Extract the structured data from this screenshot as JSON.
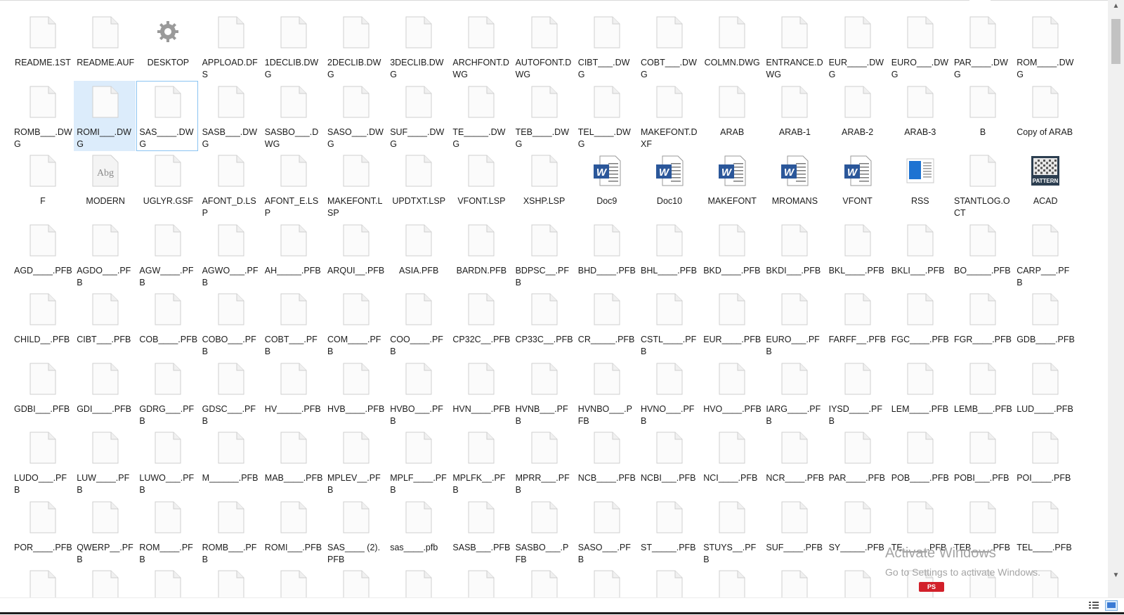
{
  "watermark": {
    "title": "Activate Windows",
    "subtitle": "Go to Settings to activate Windows."
  },
  "partial_badge": "PS",
  "colors": {
    "selection": "#dcecfb",
    "focus_border": "#8ac4f2",
    "word_blue": "#2b579a"
  },
  "files": [
    {
      "name": "README.1ST",
      "icon": "blank"
    },
    {
      "name": "README.AUF",
      "icon": "blank"
    },
    {
      "name": "DESKTOP",
      "icon": "settings"
    },
    {
      "name": "APPLOAD.DFS",
      "icon": "blank"
    },
    {
      "name": "1DECLIB.DWG",
      "icon": "blank"
    },
    {
      "name": "2DECLIB.DWG",
      "icon": "blank"
    },
    {
      "name": "3DECLIB.DWG",
      "icon": "blank"
    },
    {
      "name": "ARCHFONT.DWG",
      "icon": "blank"
    },
    {
      "name": "AUTOFONT.DWG",
      "icon": "blank"
    },
    {
      "name": "CIBT___.DWG",
      "icon": "blank"
    },
    {
      "name": "COBT___.DWG",
      "icon": "blank"
    },
    {
      "name": "COLMN.DWG",
      "icon": "blank"
    },
    {
      "name": "ENTRANCE.DWG",
      "icon": "blank"
    },
    {
      "name": "EUR____.DWG",
      "icon": "blank"
    },
    {
      "name": "EURO___.DWG",
      "icon": "blank"
    },
    {
      "name": "PAR____.DWG",
      "icon": "blank"
    },
    {
      "name": "ROM____.DWG",
      "icon": "blank"
    },
    {
      "name": "ROMB___.DWG",
      "icon": "blank"
    },
    {
      "name": "ROMI___.DWG",
      "icon": "blank",
      "selected": true
    },
    {
      "name": "SAS____.DWG",
      "icon": "blank",
      "focused": true
    },
    {
      "name": "SASB___.DWG",
      "icon": "blank"
    },
    {
      "name": "SASBO___.DWG",
      "icon": "blank"
    },
    {
      "name": "SASO___.DWG",
      "icon": "blank"
    },
    {
      "name": "SUF____.DWG",
      "icon": "blank"
    },
    {
      "name": "TE_____.DWG",
      "icon": "blank"
    },
    {
      "name": "TEB____.DWG",
      "icon": "blank"
    },
    {
      "name": "TEL____.DWG",
      "icon": "blank"
    },
    {
      "name": "MAKEFONT.DXF",
      "icon": "blank"
    },
    {
      "name": "ARAB",
      "icon": "blank"
    },
    {
      "name": "ARAB-1",
      "icon": "blank"
    },
    {
      "name": "ARAB-2",
      "icon": "blank"
    },
    {
      "name": "ARAB-3",
      "icon": "blank"
    },
    {
      "name": "B",
      "icon": "blank"
    },
    {
      "name": "Copy of ARAB",
      "icon": "blank"
    },
    {
      "name": "F",
      "icon": "blank"
    },
    {
      "name": "MODERN",
      "icon": "font",
      "icon_text": "Abg"
    },
    {
      "name": "UGLYR.GSF",
      "icon": "blank"
    },
    {
      "name": "AFONT_D.LSP",
      "icon": "blank"
    },
    {
      "name": "AFONT_E.LSP",
      "icon": "blank"
    },
    {
      "name": "MAKEFONT.LSP",
      "icon": "blank"
    },
    {
      "name": "UPDTXT.LSP",
      "icon": "blank"
    },
    {
      "name": "VFONT.LSP",
      "icon": "blank"
    },
    {
      "name": "XSHP.LSP",
      "icon": "blank"
    },
    {
      "name": "Doc9",
      "icon": "word",
      "icon_text": "W"
    },
    {
      "name": "Doc10",
      "icon": "word",
      "icon_text": "W"
    },
    {
      "name": "MAKEFONT",
      "icon": "word",
      "icon_text": "W"
    },
    {
      "name": "MROMANS",
      "icon": "word",
      "icon_text": "W"
    },
    {
      "name": "VFONT",
      "icon": "word",
      "icon_text": "W"
    },
    {
      "name": "RSS",
      "icon": "rss"
    },
    {
      "name": "STANTLOG.OCT",
      "icon": "blank"
    },
    {
      "name": "ACAD",
      "icon": "pattern",
      "icon_text": "PATTERN"
    },
    {
      "name": "AGD____.PFB",
      "icon": "blank"
    },
    {
      "name": "AGDO___.PFB",
      "icon": "blank"
    },
    {
      "name": "AGW____.PFB",
      "icon": "blank"
    },
    {
      "name": "AGWO___.PFB",
      "icon": "blank"
    },
    {
      "name": "AH_____.PFB",
      "icon": "blank"
    },
    {
      "name": "ARQUI__.PFB",
      "icon": "blank"
    },
    {
      "name": "ASIA.PFB",
      "icon": "blank"
    },
    {
      "name": "BARDN.PFB",
      "icon": "blank"
    },
    {
      "name": "BDPSC__.PFB",
      "icon": "blank"
    },
    {
      "name": "BHD____.PFB",
      "icon": "blank"
    },
    {
      "name": "BHL____.PFB",
      "icon": "blank"
    },
    {
      "name": "BKD____.PFB",
      "icon": "blank"
    },
    {
      "name": "BKDI___.PFB",
      "icon": "blank"
    },
    {
      "name": "BKL____.PFB",
      "icon": "blank"
    },
    {
      "name": "BKLI___.PFB",
      "icon": "blank"
    },
    {
      "name": "BO_____.PFB",
      "icon": "blank"
    },
    {
      "name": "CARP___.PFB",
      "icon": "blank"
    },
    {
      "name": "CHILD__.PFB",
      "icon": "blank"
    },
    {
      "name": "CIBT___.PFB",
      "icon": "blank"
    },
    {
      "name": "COB____.PFB",
      "icon": "blank"
    },
    {
      "name": "COBO___.PFB",
      "icon": "blank"
    },
    {
      "name": "COBT___.PFB",
      "icon": "blank"
    },
    {
      "name": "COM____.PFB",
      "icon": "blank"
    },
    {
      "name": "COO____.PFB",
      "icon": "blank"
    },
    {
      "name": "CP32C__.PFB",
      "icon": "blank"
    },
    {
      "name": "CP33C__.PFB",
      "icon": "blank"
    },
    {
      "name": "CR_____.PFB",
      "icon": "blank"
    },
    {
      "name": "CSTL____.PFB",
      "icon": "blank"
    },
    {
      "name": "EUR____.PFB",
      "icon": "blank"
    },
    {
      "name": "EURO___.PFB",
      "icon": "blank"
    },
    {
      "name": "FARFF__.PFB",
      "icon": "blank"
    },
    {
      "name": "FGC____.PFB",
      "icon": "blank"
    },
    {
      "name": "FGR____.PFB",
      "icon": "blank"
    },
    {
      "name": "GDB____.PFB",
      "icon": "blank"
    },
    {
      "name": "GDBI___.PFB",
      "icon": "blank"
    },
    {
      "name": "GDI____.PFB",
      "icon": "blank"
    },
    {
      "name": "GDRG___.PFB",
      "icon": "blank"
    },
    {
      "name": "GDSC___.PFB",
      "icon": "blank"
    },
    {
      "name": "HV_____.PFB",
      "icon": "blank"
    },
    {
      "name": "HVB____.PFB",
      "icon": "blank"
    },
    {
      "name": "HVBO___.PFB",
      "icon": "blank"
    },
    {
      "name": "HVN____.PFB",
      "icon": "blank"
    },
    {
      "name": "HVNB___.PFB",
      "icon": "blank"
    },
    {
      "name": "HVNBO___.PFB",
      "icon": "blank"
    },
    {
      "name": "HVNO___.PFB",
      "icon": "blank"
    },
    {
      "name": "HVO____.PFB",
      "icon": "blank"
    },
    {
      "name": "IARG____.PFB",
      "icon": "blank"
    },
    {
      "name": "IYSD____.PFB",
      "icon": "blank"
    },
    {
      "name": "LEM____.PFB",
      "icon": "blank"
    },
    {
      "name": "LEMB___.PFB",
      "icon": "blank"
    },
    {
      "name": "LUD____.PFB",
      "icon": "blank"
    },
    {
      "name": "LUDO___.PFB",
      "icon": "blank"
    },
    {
      "name": "LUW____.PFB",
      "icon": "blank"
    },
    {
      "name": "LUWO___.PFB",
      "icon": "blank"
    },
    {
      "name": "M______.PFB",
      "icon": "blank"
    },
    {
      "name": "MAB____.PFB",
      "icon": "blank"
    },
    {
      "name": "MPLEV__.PFB",
      "icon": "blank"
    },
    {
      "name": "MPLF____.PFB",
      "icon": "blank"
    },
    {
      "name": "MPLFK__.PFB",
      "icon": "blank"
    },
    {
      "name": "MPRR___.PFB",
      "icon": "blank"
    },
    {
      "name": "NCB____.PFB",
      "icon": "blank"
    },
    {
      "name": "NCBI___.PFB",
      "icon": "blank"
    },
    {
      "name": "NCI____.PFB",
      "icon": "blank"
    },
    {
      "name": "NCR____.PFB",
      "icon": "blank"
    },
    {
      "name": "PAR____.PFB",
      "icon": "blank"
    },
    {
      "name": "POB____.PFB",
      "icon": "blank"
    },
    {
      "name": "POBI___.PFB",
      "icon": "blank"
    },
    {
      "name": "POI____.PFB",
      "icon": "blank"
    },
    {
      "name": "POR____.PFB",
      "icon": "blank"
    },
    {
      "name": "QWERP__.PFB",
      "icon": "blank"
    },
    {
      "name": "ROM____.PFB",
      "icon": "blank"
    },
    {
      "name": "ROMB___.PFB",
      "icon": "blank"
    },
    {
      "name": "ROMI___.PFB",
      "icon": "blank"
    },
    {
      "name": "SAS____ (2).PFB",
      "icon": "blank"
    },
    {
      "name": "sas____.pfb",
      "icon": "blank"
    },
    {
      "name": "SASB___.PFB",
      "icon": "blank"
    },
    {
      "name": "SASBO___.PFB",
      "icon": "blank"
    },
    {
      "name": "SASO___.PFB",
      "icon": "blank"
    },
    {
      "name": "ST_____.PFB",
      "icon": "blank"
    },
    {
      "name": "STUYS__.PFB",
      "icon": "blank"
    },
    {
      "name": "SUF____.PFB",
      "icon": "blank"
    },
    {
      "name": "SY_____.PFB",
      "icon": "blank"
    },
    {
      "name": "TE_____.PFB",
      "icon": "blank"
    },
    {
      "name": "TEB____.PFB",
      "icon": "blank"
    },
    {
      "name": "TEL____.PFB",
      "icon": "blank"
    }
  ]
}
